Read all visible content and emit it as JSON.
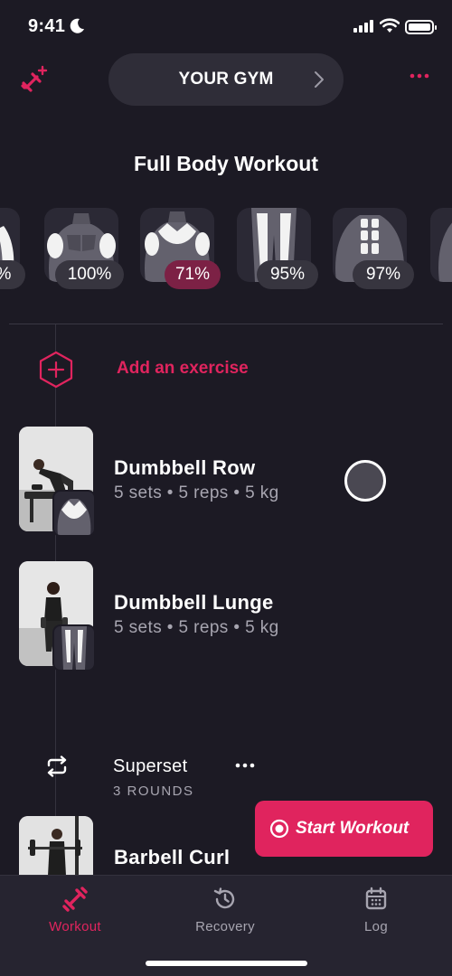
{
  "status_bar": {
    "time": "9:41"
  },
  "header": {
    "gym_label": "YOUR GYM"
  },
  "workout": {
    "title": "Full Body Workout"
  },
  "muscle_groups": [
    {
      "percent": "%"
    },
    {
      "percent": "100%"
    },
    {
      "percent": "71%"
    },
    {
      "percent": "95%"
    },
    {
      "percent": "97%"
    }
  ],
  "add_exercise": {
    "label": "Add an exercise"
  },
  "exercises": [
    {
      "name": "Dumbbell Row",
      "meta": "5 sets • 5 reps • 5 kg"
    },
    {
      "name": "Dumbbell Lunge",
      "meta": "5 sets • 5 reps • 5 kg"
    }
  ],
  "superset": {
    "label": "Superset",
    "rounds": "3 ROUNDS",
    "exercises": [
      {
        "name": "Barbell Curl"
      }
    ]
  },
  "start_button": {
    "label": "Start Workout"
  },
  "tabs": [
    {
      "label": "Workout",
      "icon": "dumbbell-icon",
      "active": true
    },
    {
      "label": "Recovery",
      "icon": "recovery-icon",
      "active": false
    },
    {
      "label": "Log",
      "icon": "calendar-icon",
      "active": false
    }
  ],
  "colors": {
    "accent": "#e0245e",
    "background": "#1c1a24",
    "warn_badge": "#7c2145"
  }
}
